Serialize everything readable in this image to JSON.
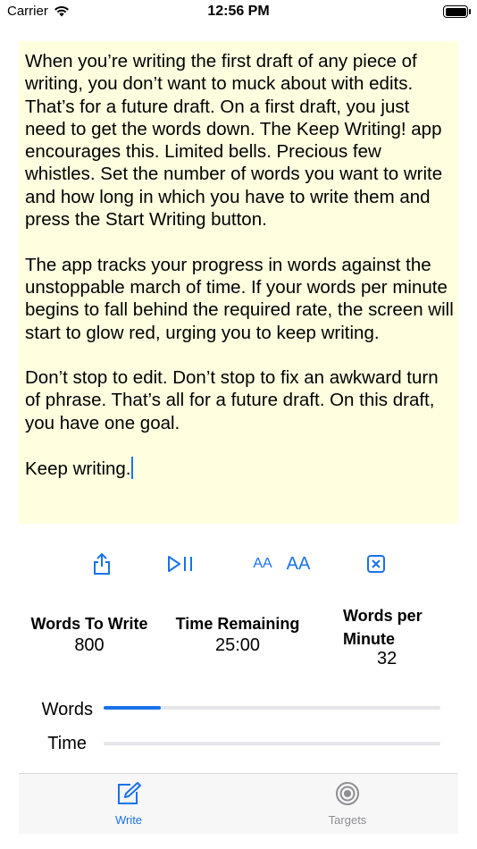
{
  "status_bar": {
    "carrier": "Carrier",
    "time": "12:56 PM"
  },
  "editor": {
    "paragraphs": [
      "When you’re writing the first draft of any piece of writing, you don’t want to muck about with edits. That’s for a future draft. On a first draft, you just need to get the words down. The Keep Writing! app encourages this. Limited bells. Precious few whistles. Set the number of words you want to write and how long in which you have to write them and press the Start Writing button.",
      "The app tracks your progress in words against the unstoppable march of time. If your words per minute begins to fall behind the required rate, the screen will start to glow red, urging you to keep writing.",
      "Don’t stop to edit. Don’t stop to fix an awkward turn of phrase. That’s all for a future draft. On this draft, you have one goal.",
      "Keep writing."
    ],
    "background": "#ffffe0"
  },
  "toolbar": {
    "share_icon": "share-icon",
    "play_pause_icon": "play-pause-icon",
    "font_small_label": "AA",
    "font_large_label": "AA",
    "clear_icon": "clear-icon",
    "accent": "#1a72e8"
  },
  "stats": {
    "words_to_write": {
      "label": "Words To Write",
      "value": "800"
    },
    "time_remaining": {
      "label": "Time Remaining",
      "value": "25:00"
    },
    "words_per_minute": {
      "label_line1": "Words per",
      "label_line2": "Minute",
      "value": "32"
    }
  },
  "progress": {
    "words": {
      "label": "Words",
      "fraction": 0.17
    },
    "time": {
      "label": "Time",
      "fraction": 0.0
    }
  },
  "tab_bar": {
    "tabs": [
      {
        "label": "Write",
        "icon": "compose-icon",
        "selected": true
      },
      {
        "label": "Targets",
        "icon": "target-icon",
        "selected": false
      }
    ]
  }
}
